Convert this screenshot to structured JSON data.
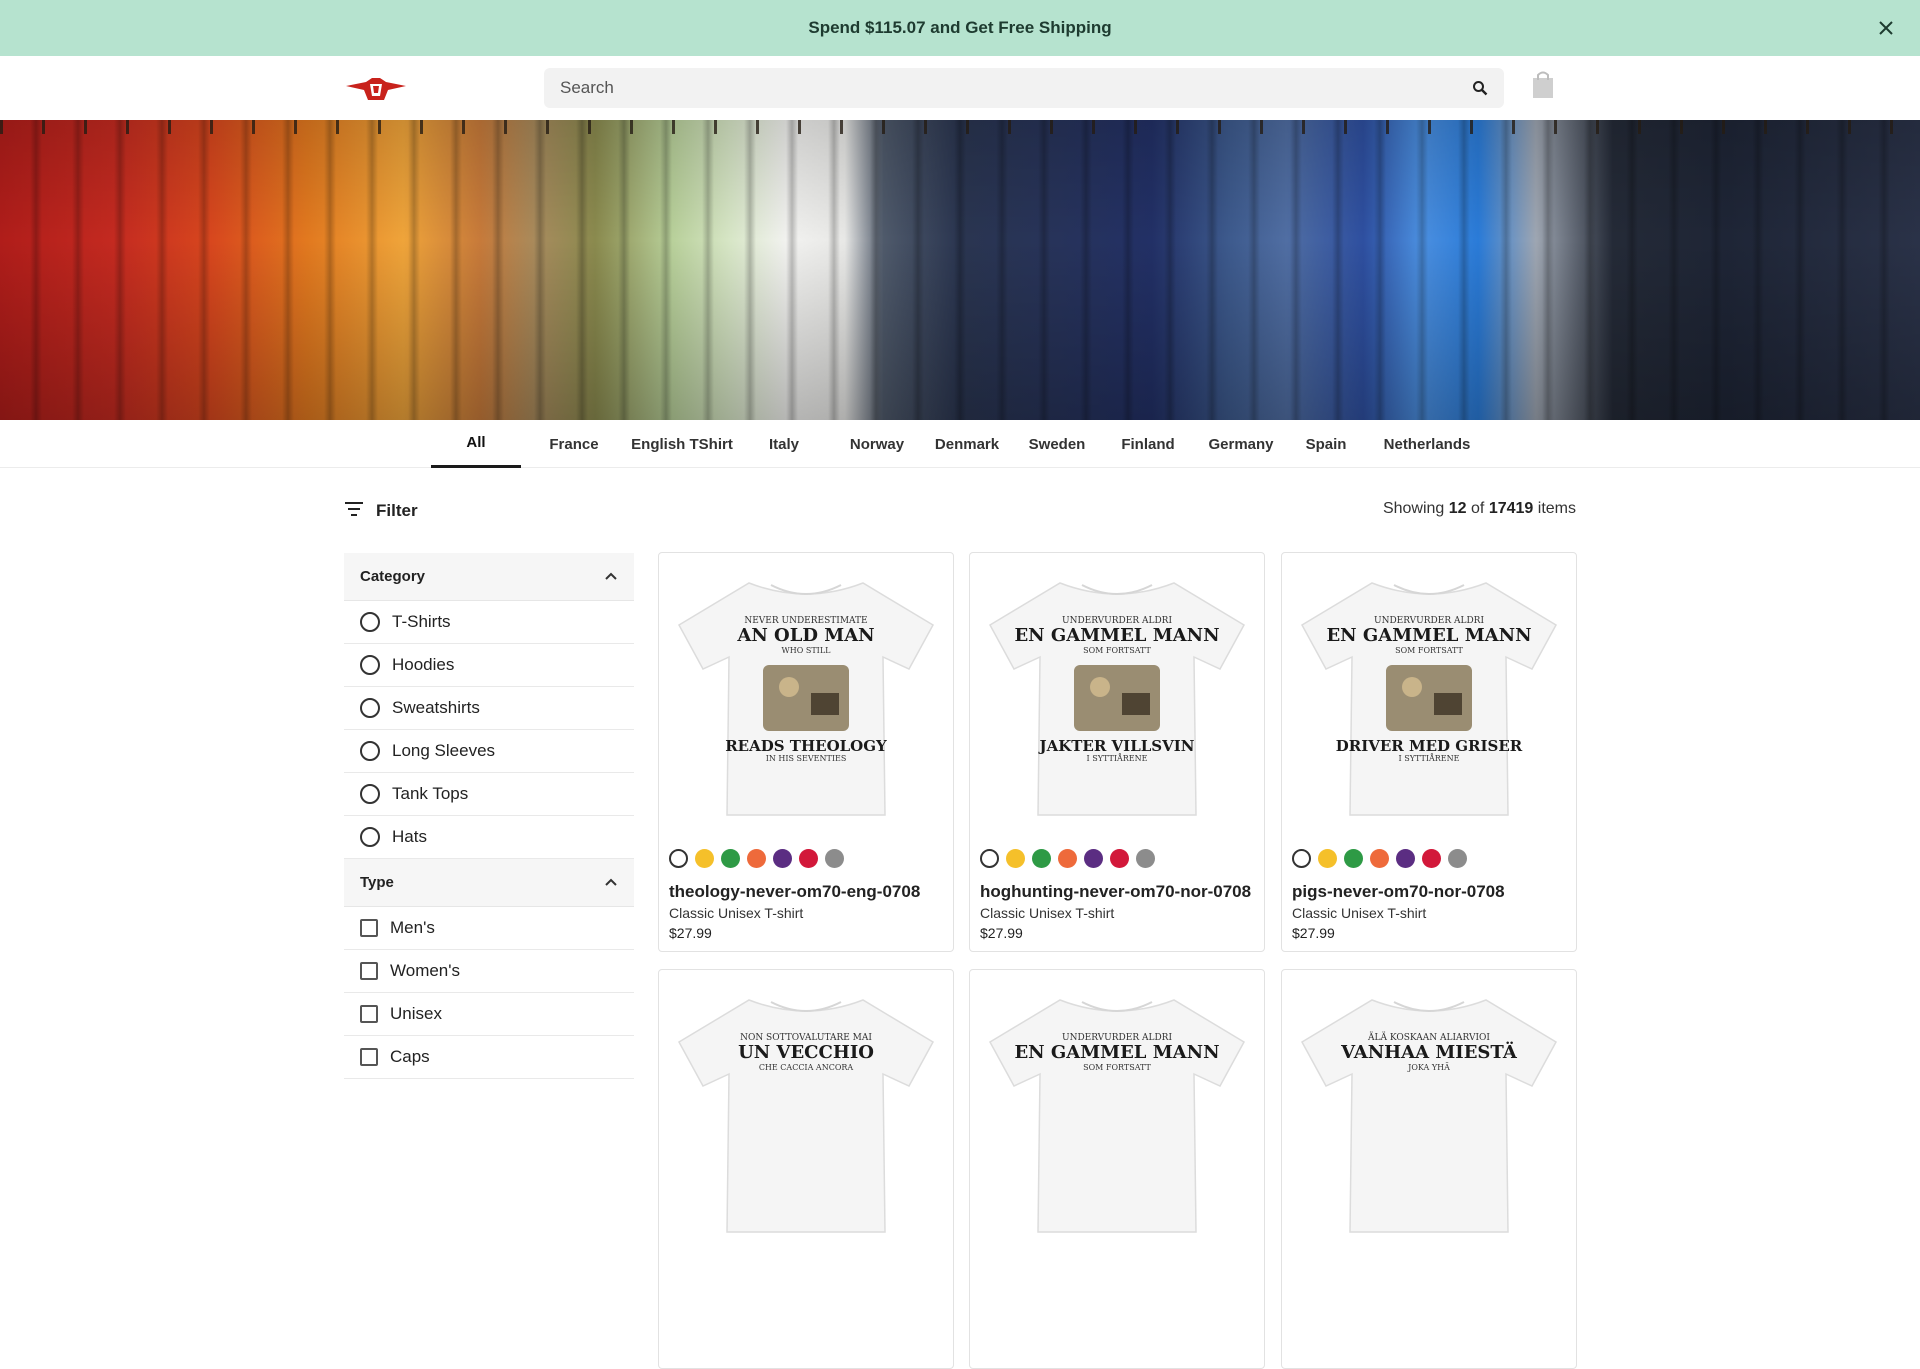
{
  "announcement": {
    "text": "Spend $115.07 and Get Free Shipping",
    "close_icon": "close-icon"
  },
  "header": {
    "logo": "red-eagle-shirt-logo",
    "search": {
      "placeholder": "Search",
      "icon": "search-icon"
    },
    "cart_icon": "shopping-bag-icon"
  },
  "tabs": [
    {
      "label": "All",
      "active": true
    },
    {
      "label": "France"
    },
    {
      "label": "English TShirt"
    },
    {
      "label": "Italy"
    },
    {
      "label": "Norway"
    },
    {
      "label": "Denmark"
    },
    {
      "label": "Sweden"
    },
    {
      "label": "Finland"
    },
    {
      "label": "Germany"
    },
    {
      "label": "Spain"
    },
    {
      "label": "Netherlands"
    }
  ],
  "filter": {
    "label": "Filter",
    "icon": "filter-lines-icon"
  },
  "results": {
    "prefix": "Showing",
    "shown": "12",
    "of": "of",
    "total": "17419",
    "suffix": "items"
  },
  "sidebar": {
    "category": {
      "title": "Category",
      "options": [
        "T-Shirts",
        "Hoodies",
        "Sweatshirts",
        "Long Sleeves",
        "Tank Tops",
        "Hats"
      ]
    },
    "type": {
      "title": "Type",
      "options": [
        "Men's",
        "Women's",
        "Unisex",
        "Caps"
      ]
    }
  },
  "swatch_colors": [
    "#ffffff",
    "#f5c02a",
    "#2e9a45",
    "#ee6a3b",
    "#5b2d82",
    "#d2183a",
    "#8c8c8c"
  ],
  "products": [
    {
      "name": "theology-never-om70-eng-0708",
      "type": "Classic Unisex T-shirt",
      "price": "$27.99",
      "print_top": "NEVER UNDERESTIMATE",
      "print_main": "AN OLD MAN",
      "print_sub": "WHO STILL",
      "print_bottom": "READS THEOLOGY",
      "print_foot": "IN HIS SEVENTIES"
    },
    {
      "name": "hoghunting-never-om70-nor-0708",
      "type": "Classic Unisex T-shirt",
      "price": "$27.99",
      "print_top": "UNDERVURDER ALDRI",
      "print_main": "EN GAMMEL MANN",
      "print_sub": "SOM FORTSATT",
      "print_bottom": "JAKTER VILLSVIN",
      "print_foot": "I SYTTIÅRENE"
    },
    {
      "name": "pigs-never-om70-nor-0708",
      "type": "Classic Unisex T-shirt",
      "price": "$27.99",
      "print_top": "UNDERVURDER ALDRI",
      "print_main": "EN GAMMEL MANN",
      "print_sub": "SOM FORTSATT",
      "print_bottom": "DRIVER MED GRISER",
      "print_foot": "I SYTTIÅRENE"
    },
    {
      "print_top": "NON SOTTOVALUTARE MAI",
      "print_main": "UN VECCHIO",
      "print_sub": "CHE CACCIA ANCORA"
    },
    {
      "print_top": "UNDERVURDER ALDRI",
      "print_main": "EN GAMMEL MANN",
      "print_sub": "SOM FORTSATT"
    },
    {
      "print_top": "ÄLÄ KOSKAAN ALIARVIOI",
      "print_main": "VANHAA MIESTÄ",
      "print_sub": "JOKA YHÄ"
    }
  ]
}
